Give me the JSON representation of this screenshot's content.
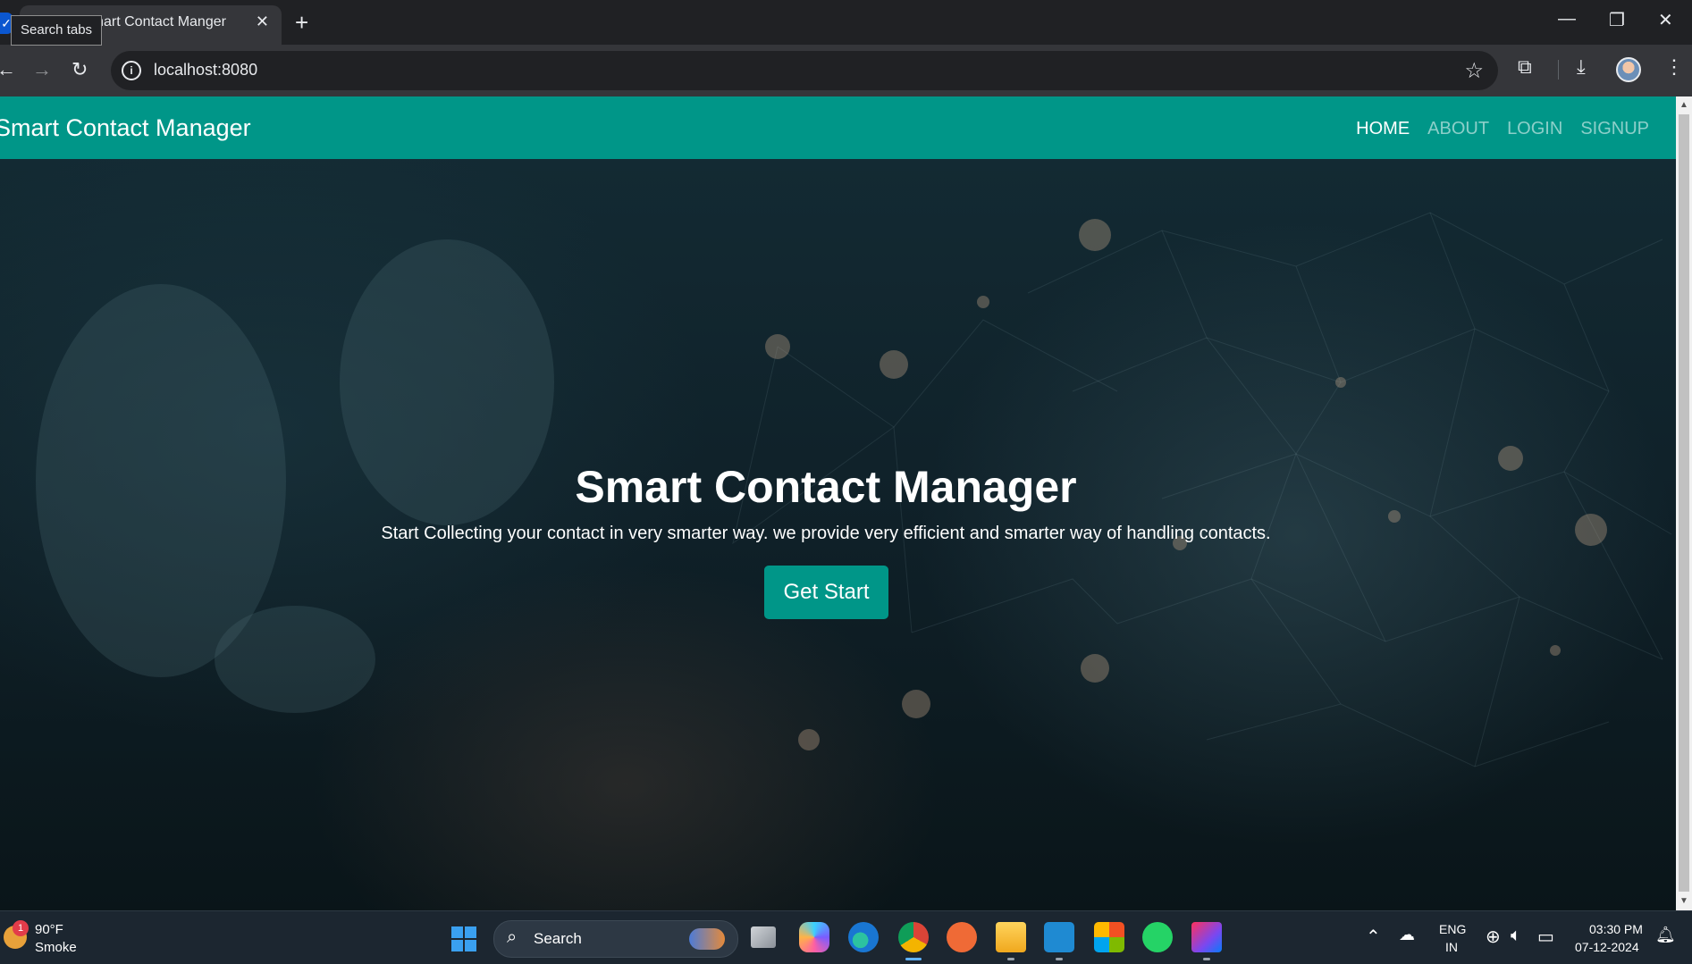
{
  "browser": {
    "tab_title": "Smart Contact Manger",
    "tooltip": "Search tabs",
    "new_tab_symbol": "+",
    "close_symbol": "✕",
    "url": "localhost:8080",
    "icons": [
      "back-arrow-icon",
      "forward-arrow-icon",
      "reload-icon",
      "site-info-icon",
      "bookmark-star-icon",
      "extensions-icon",
      "download-icon",
      "profile-avatar",
      "more-menu-icon"
    ],
    "window_controls": [
      "minimize",
      "maximize",
      "close"
    ]
  },
  "navbar": {
    "brand": "Smart Contact Manager",
    "links": [
      {
        "label": "HOME",
        "active": true
      },
      {
        "label": "ABOUT",
        "active": false
      },
      {
        "label": "LOGIN",
        "active": false
      },
      {
        "label": "SIGNUP",
        "active": false
      }
    ],
    "color": "#009688"
  },
  "hero": {
    "title": "Smart Contact Manager",
    "subtitle": "Start Collecting your contact in very smarter way. we provide very efficient and smarter way of handling contacts.",
    "button": "Get Start"
  },
  "taskbar": {
    "weather": {
      "temp": "90°F",
      "condition": "Smoke",
      "badge": "1"
    },
    "search_label": "Search",
    "apps": [
      "task-view",
      "copilot",
      "edge",
      "chrome",
      "postman",
      "file-explorer",
      "vscode",
      "microsoft-store",
      "whatsapp",
      "intellij"
    ],
    "language": {
      "line1": "ENG",
      "line2": "IN"
    },
    "clock": {
      "time": "03:30 PM",
      "date": "07-12-2024"
    }
  }
}
